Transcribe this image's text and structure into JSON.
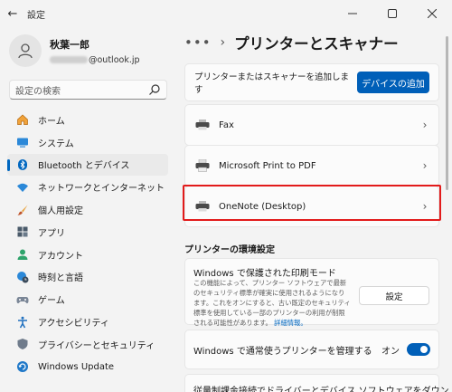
{
  "app": {
    "title": "設定"
  },
  "profile": {
    "name": "秋葉一郎",
    "email_visible": "@outlook.jp"
  },
  "search": {
    "placeholder": "設定の検索"
  },
  "sidebar": {
    "items": [
      {
        "label": "ホーム",
        "icon": "home-icon"
      },
      {
        "label": "システム",
        "icon": "system-icon"
      },
      {
        "label": "Bluetooth とデバイス",
        "icon": "bluetooth-icon",
        "active": true
      },
      {
        "label": "ネットワークとインターネット",
        "icon": "wifi-icon"
      },
      {
        "label": "個人用設定",
        "icon": "brush-icon"
      },
      {
        "label": "アプリ",
        "icon": "apps-icon"
      },
      {
        "label": "アカウント",
        "icon": "account-icon"
      },
      {
        "label": "時刻と言語",
        "icon": "globe-clock-icon"
      },
      {
        "label": "ゲーム",
        "icon": "gamepad-icon"
      },
      {
        "label": "アクセシビリティ",
        "icon": "accessibility-icon"
      },
      {
        "label": "プライバシーとセキュリティ",
        "icon": "shield-icon"
      },
      {
        "label": "Windows Update",
        "icon": "update-icon"
      }
    ]
  },
  "breadcrumb": {
    "dots": "•••",
    "separator": "›",
    "title": "プリンターとスキャナー"
  },
  "add_row": {
    "label": "プリンターまたはスキャナーを追加します",
    "button": "デバイスの追加"
  },
  "printers": [
    {
      "label": "Fax",
      "icon": "printer-icon"
    },
    {
      "label": "Microsoft Print to PDF",
      "icon": "printer-icon"
    },
    {
      "label": "OneNote (Desktop)",
      "icon": "printer-icon"
    }
  ],
  "preferences": {
    "title": "プリンターの環境設定",
    "protected_mode": {
      "title": "Windows で保護された印刷モード",
      "description": "この機能によって、プリンター ソフトウェアで最新のセキュリティ標準が確実に使用されるようになります。これをオンにすると、古い既定のセキュリティ標準を使用している一部のプリンターの利用が制限される可能性があります。",
      "link": "詳細情報。",
      "button": "設定"
    },
    "manage_default": {
      "label": "Windows で通常使うプリンターを管理する",
      "toggle_text": "オン",
      "toggle_on": true
    },
    "metered": {
      "label": "従量制課金接続でドライバーとデバイス ソフトウェアをダウン"
    }
  },
  "colors": {
    "accent": "#005fb8",
    "highlight": "#e21b1b"
  }
}
